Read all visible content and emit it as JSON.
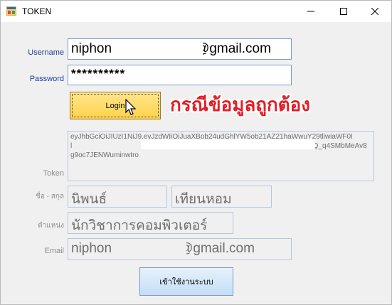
{
  "window": {
    "title": "TOKEN",
    "minimize_icon": "minimize-icon",
    "maximize_icon": "maximize-icon",
    "close_icon": "close-icon"
  },
  "form": {
    "username_label": "Username",
    "username_value": "niphon.thee               @gmail.com",
    "username_prefix": "niphon",
    "username_suffix": "@gmail.com",
    "password_label": "Password",
    "password_value": "**********",
    "login_button": "Login",
    "annotation": "กรณีข้อมูลถูกต้อง"
  },
  "result": {
    "token_label": "Token",
    "token_line1": "eyJhbGciOiJIUzI1NiJ9.eyJzdWIiOiJuaXBob24udGhlYW5ob21AZ21haWwuY29tliwiaWF0I",
    "token_line2_end": "PQ_q4SMbMeAv8",
    "token_line3": "g9oc7JENWuminwtro",
    "fullname_label": "ชื่อ - สกุล",
    "first_name": "นิพนธ์",
    "last_name": "เทียนหอม",
    "position_label": "ตำแหน่ง",
    "position_value": "นักวิชาการคอมพิวเตอร์",
    "email_label": "Email",
    "email_prefix": "niphon",
    "email_suffix": "@gmail.com",
    "enter_button": "เข้าใช้งานระบบ"
  },
  "colors": {
    "label_blue": "#1d3f9b",
    "label_gray": "#8f8f8f",
    "annotation_red": "#e31e24",
    "login_button": "#ffd24a"
  }
}
